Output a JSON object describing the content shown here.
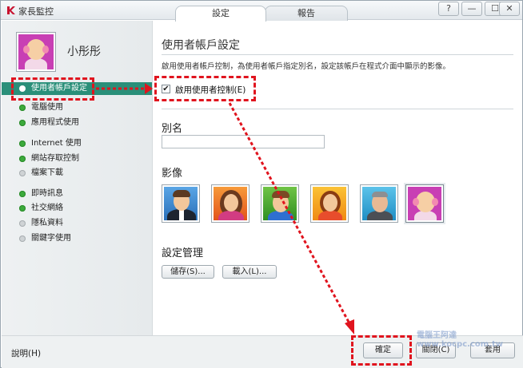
{
  "window": {
    "app_title": "家長監控",
    "tabs": [
      {
        "label": "設定",
        "active": true
      },
      {
        "label": "報告",
        "active": false
      }
    ],
    "controls": {
      "help": "?",
      "minimize": "—",
      "maximize": "☐",
      "close": "✕"
    }
  },
  "sidebar": {
    "profile_name": "小彤彤",
    "items": [
      {
        "label": "使用者帳戶設定",
        "status": "white",
        "active": true
      },
      {
        "label": "電腦使用",
        "status": "green"
      },
      {
        "label": "應用程式使用",
        "status": "green"
      },
      {
        "label": "Internet 使用",
        "status": "green"
      },
      {
        "label": "網站存取控制",
        "status": "green"
      },
      {
        "label": "檔案下載",
        "status": "grey"
      },
      {
        "label": "即時訊息",
        "status": "green"
      },
      {
        "label": "社交網絡",
        "status": "green"
      },
      {
        "label": "隱私資料",
        "status": "grey"
      },
      {
        "label": "關鍵字使用",
        "status": "grey"
      }
    ]
  },
  "main": {
    "section_title": "使用者帳戶設定",
    "description": "啟用使用者帳戶控制，為使用者帳戶指定別名，設定該帳戶在程式介面中顯示的影像。",
    "enable_checkbox": {
      "label": "啟用使用者控制(E)",
      "checked": true,
      "mark": "✔"
    },
    "alias_label": "別名",
    "alias_value": "",
    "image_label": "影像",
    "images": [
      {
        "name": "man-suit",
        "bg": "#3d8ed8"
      },
      {
        "name": "woman",
        "bg": "#ef6a1e"
      },
      {
        "name": "boy",
        "bg": "#4cae2e"
      },
      {
        "name": "girl",
        "bg": "#f5a51b"
      },
      {
        "name": "man-grey",
        "bg": "#35a4d6"
      },
      {
        "name": "baby",
        "bg": "#c83fb4",
        "selected": true
      }
    ],
    "management_label": "設定管理",
    "save_button": "儲存(S)...",
    "load_button": "載入(L)..."
  },
  "bottom": {
    "help_link": "說明(H)",
    "ok_button": "確定",
    "close_button": "關閉(C)",
    "apply_button": "套用"
  },
  "watermark": "電腦王阿達 www.kocpc.com.tw",
  "colors": {
    "accent": "#2a8f79",
    "annotation": "#e0141e"
  }
}
